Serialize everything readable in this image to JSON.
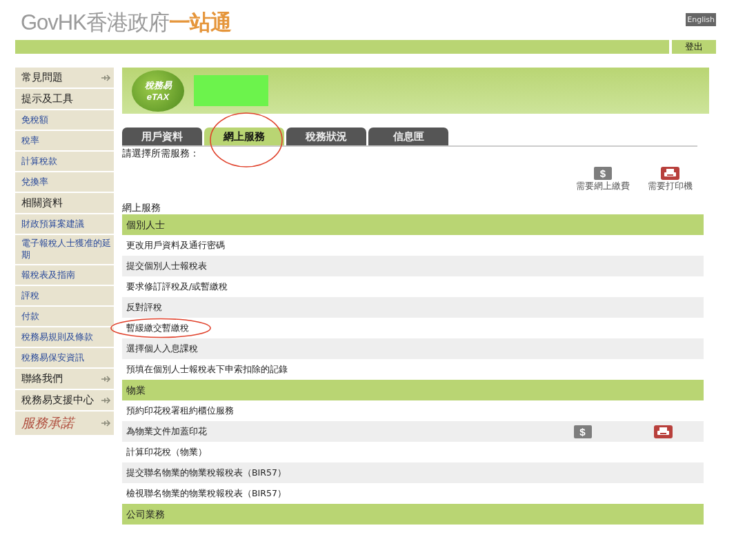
{
  "header": {
    "logo": [
      {
        "text": "GovHK",
        "kind": "latin"
      },
      {
        "text": "香港政府",
        "kind": "grey"
      },
      {
        "text": "一站通",
        "kind": "orange"
      }
    ],
    "language_button": "English",
    "logout_button": "登出"
  },
  "sidebar": {
    "items": [
      {
        "label": "常見問題",
        "kind": "heading",
        "arrow": true
      },
      {
        "label": "提示及工具",
        "kind": "heading",
        "arrow": false
      },
      {
        "label": "免稅額",
        "kind": "link",
        "arrow": false
      },
      {
        "label": "稅率",
        "kind": "link",
        "arrow": false
      },
      {
        "label": "計算稅款",
        "kind": "link",
        "arrow": false
      },
      {
        "label": "兌換率",
        "kind": "link",
        "arrow": false
      },
      {
        "label": "相關資料",
        "kind": "heading",
        "arrow": false
      },
      {
        "label": "財政預算案建議",
        "kind": "link",
        "arrow": false
      },
      {
        "label": "電子報稅人士獲准的延期",
        "kind": "link",
        "arrow": false
      },
      {
        "label": "報稅表及指南",
        "kind": "link",
        "arrow": false
      },
      {
        "label": "評稅",
        "kind": "link",
        "arrow": false
      },
      {
        "label": "付款",
        "kind": "link",
        "arrow": false
      },
      {
        "label": "稅務易規則及條款",
        "kind": "link",
        "arrow": false
      },
      {
        "label": "稅務易保安資訊",
        "kind": "link",
        "arrow": false
      },
      {
        "label": "聯絡我們",
        "kind": "heading",
        "arrow": true
      },
      {
        "label": "稅務易支援中心",
        "kind": "heading",
        "arrow": true
      },
      {
        "label": "服務承諾",
        "kind": "pledge",
        "arrow": true
      }
    ]
  },
  "banner": {
    "logo_text": "稅務易",
    "logo_subtext": "eTAX"
  },
  "tabs": [
    {
      "label": "用戶資料",
      "selected": false
    },
    {
      "label": "網上服務",
      "selected": true
    },
    {
      "label": "稅務狀況",
      "selected": false
    },
    {
      "label": "信息匣",
      "selected": false
    }
  ],
  "prompt": "請選擇所需服務：",
  "legend": [
    {
      "kind": "payment",
      "glyph": "$",
      "label": "需要網上繳費"
    },
    {
      "kind": "printer",
      "label": "需要打印機"
    }
  ],
  "services_title": "網上服務",
  "sections": [
    {
      "title": "個別人士",
      "rows": [
        {
          "label": "更改用戶資料及通行密碼",
          "payment": false,
          "printer": false
        },
        {
          "label": "提交個別人士報稅表",
          "payment": false,
          "printer": false
        },
        {
          "label": "要求修訂評稅及/或暫繳稅",
          "payment": false,
          "printer": false
        },
        {
          "label": "反對評稅",
          "payment": false,
          "printer": false
        },
        {
          "label": "暫緩繳交暫繳稅",
          "payment": false,
          "printer": false
        },
        {
          "label": "選擇個人入息課稅",
          "payment": false,
          "printer": false
        },
        {
          "label": "預填在個別人士報稅表下申索扣除的記錄",
          "payment": false,
          "printer": false
        }
      ]
    },
    {
      "title": "物業",
      "rows": [
        {
          "label": "預約印花稅署租約櫃位服務",
          "payment": false,
          "printer": false
        },
        {
          "label": "為物業文件加蓋印花",
          "payment": true,
          "payment_glyph": "$",
          "printer": true
        },
        {
          "label": "計算印花稅（物業）",
          "payment": false,
          "printer": false
        },
        {
          "label": "提交聯名物業的物業稅報稅表（BIR57）",
          "payment": false,
          "printer": false
        },
        {
          "label": "檢視聯名物業的物業稅報稅表（BIR57）",
          "payment": false,
          "printer": false
        }
      ]
    },
    {
      "title": "公司業務"
    }
  ]
}
